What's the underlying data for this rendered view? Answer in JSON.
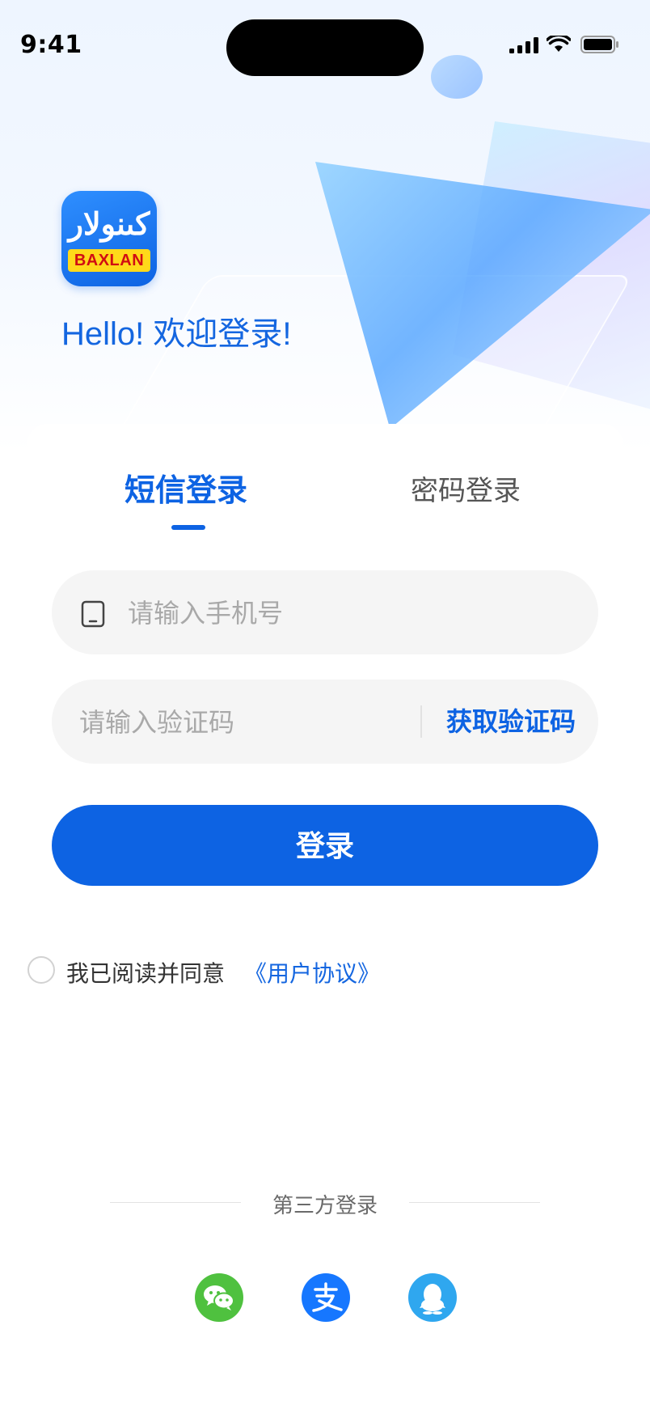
{
  "status_bar": {
    "time": "9:41"
  },
  "logo": {
    "script_text": "كىنولار",
    "plate_text": "BAXLAN"
  },
  "welcome_text": "Hello! 欢迎登录!",
  "tabs": [
    {
      "label": "短信登录",
      "active": true
    },
    {
      "label": "密码登录",
      "active": false
    }
  ],
  "form": {
    "phone_placeholder": "请输入手机号",
    "phone_value": "",
    "code_placeholder": "请输入验证码",
    "code_value": "",
    "get_code_label": "获取验证码",
    "login_label": "登录"
  },
  "agreement": {
    "checked": false,
    "text": "我已阅读并同意",
    "link": "《用户协议》"
  },
  "third_party": {
    "label": "第三方登录",
    "providers": [
      "wechat-icon",
      "alipay-icon",
      "qq-icon"
    ]
  },
  "colors": {
    "primary": "#0d63e3",
    "wechat": "#4fc13f",
    "alipay": "#1677ff",
    "qq": "#2fa7ef"
  }
}
